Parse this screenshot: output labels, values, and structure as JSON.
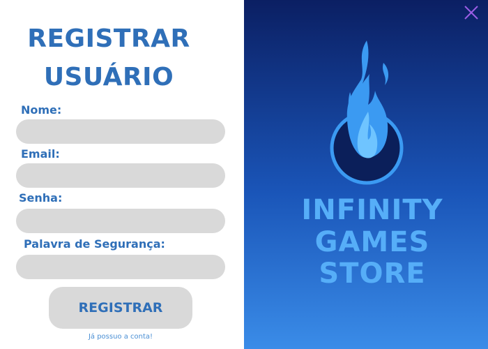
{
  "form": {
    "title_line1": "REGISTRAR",
    "title_line2": "USUÁRIO",
    "fields": [
      {
        "label": "Nome:",
        "value": "",
        "placeholder": ""
      },
      {
        "label": "Email:",
        "value": "",
        "placeholder": ""
      },
      {
        "label": "Senha:",
        "value": "",
        "placeholder": ""
      },
      {
        "label": "Palavra de Segurança:",
        "value": "",
        "placeholder": ""
      }
    ],
    "submit_label": "REGISTRAR",
    "login_link": "Já possuo a conta!"
  },
  "brand": {
    "line1": "INFINITY",
    "line2": "GAMES",
    "line3": "STORE",
    "logo_icon": "flame-logo-icon"
  },
  "close_icon": "close-icon",
  "colors": {
    "accent": "#2f6fb8",
    "input_bg": "#d9d9d9",
    "panel_top": "#0b1f63",
    "panel_bottom": "#3a8ce8",
    "brand_text": "#56aef8",
    "close": "#9b5de5"
  }
}
